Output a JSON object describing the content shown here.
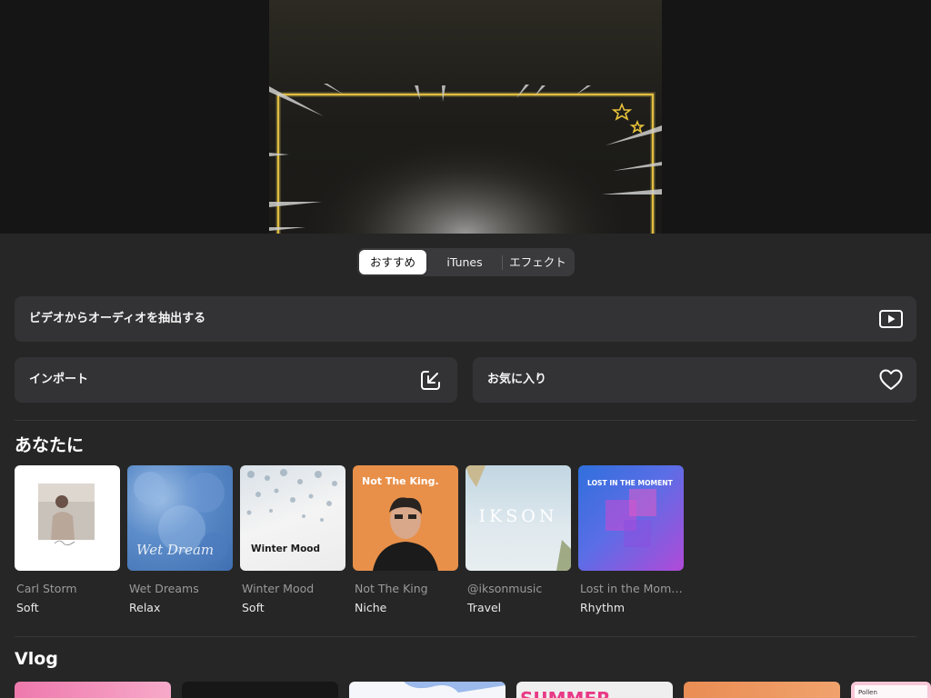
{
  "segment": {
    "tabs": [
      {
        "label": "おすすめ",
        "active": true
      },
      {
        "label": "iTunes",
        "active": false
      },
      {
        "label": "エフェクト",
        "active": false
      }
    ]
  },
  "actions": {
    "extract_audio": {
      "label": "ビデオからオーディオを抽出する",
      "icon": "play-box-icon"
    },
    "import": {
      "label": "インポート",
      "icon": "import-arrow-icon"
    },
    "favorites": {
      "label": "お気に入り",
      "icon": "heart-icon"
    }
  },
  "for_you": {
    "title": "あなたに",
    "items": [
      {
        "title": "Carl Storm",
        "category": "Soft",
        "cover_text": "",
        "cover_colors": [
          "#ffffff",
          "#d8d4cf"
        ]
      },
      {
        "title": "Wet Dreams",
        "category": "Relax",
        "cover_text": "Wet Dream",
        "cover_colors": [
          "#4f7fbf",
          "#a8c4e4"
        ]
      },
      {
        "title": "Winter Mood",
        "category": "Soft",
        "cover_text": "Winter Mood",
        "cover_colors": [
          "#f2f2f2",
          "#c9d2da"
        ]
      },
      {
        "title": "Not The King",
        "category": "Niche",
        "cover_text": "Not The King.",
        "cover_colors": [
          "#e58a3e",
          "#f2a65a"
        ]
      },
      {
        "title": "@iksonmusic",
        "category": "Travel",
        "cover_text": "IKSON",
        "cover_colors": [
          "#c7d8e2",
          "#e6eef2"
        ]
      },
      {
        "title": "Lost in the Mom…",
        "category": "Rhythm",
        "cover_text": "LOST IN THE MOMENT",
        "cover_colors": [
          "#3c7bdc",
          "#c54ad6"
        ]
      }
    ]
  },
  "vlog": {
    "title": "Vlog",
    "items": [
      {
        "cover_text": "",
        "cover_colors": [
          "#ef7fb0",
          "#f6a5c8"
        ]
      },
      {
        "cover_text": "",
        "cover_colors": [
          "#141414",
          "#222222"
        ]
      },
      {
        "cover_text": "",
        "cover_colors": [
          "#f4f6fb",
          "#8fb0e6"
        ]
      },
      {
        "cover_text": "SUMMER",
        "cover_colors": [
          "#f3f3f3",
          "#e0e0e0"
        ]
      },
      {
        "cover_text": "",
        "cover_colors": [
          "#e98e55",
          "#f2a36e"
        ]
      },
      {
        "cover_text": "Pollen",
        "cover_colors": [
          "#f7c9d9",
          "#ffffff"
        ]
      }
    ]
  }
}
